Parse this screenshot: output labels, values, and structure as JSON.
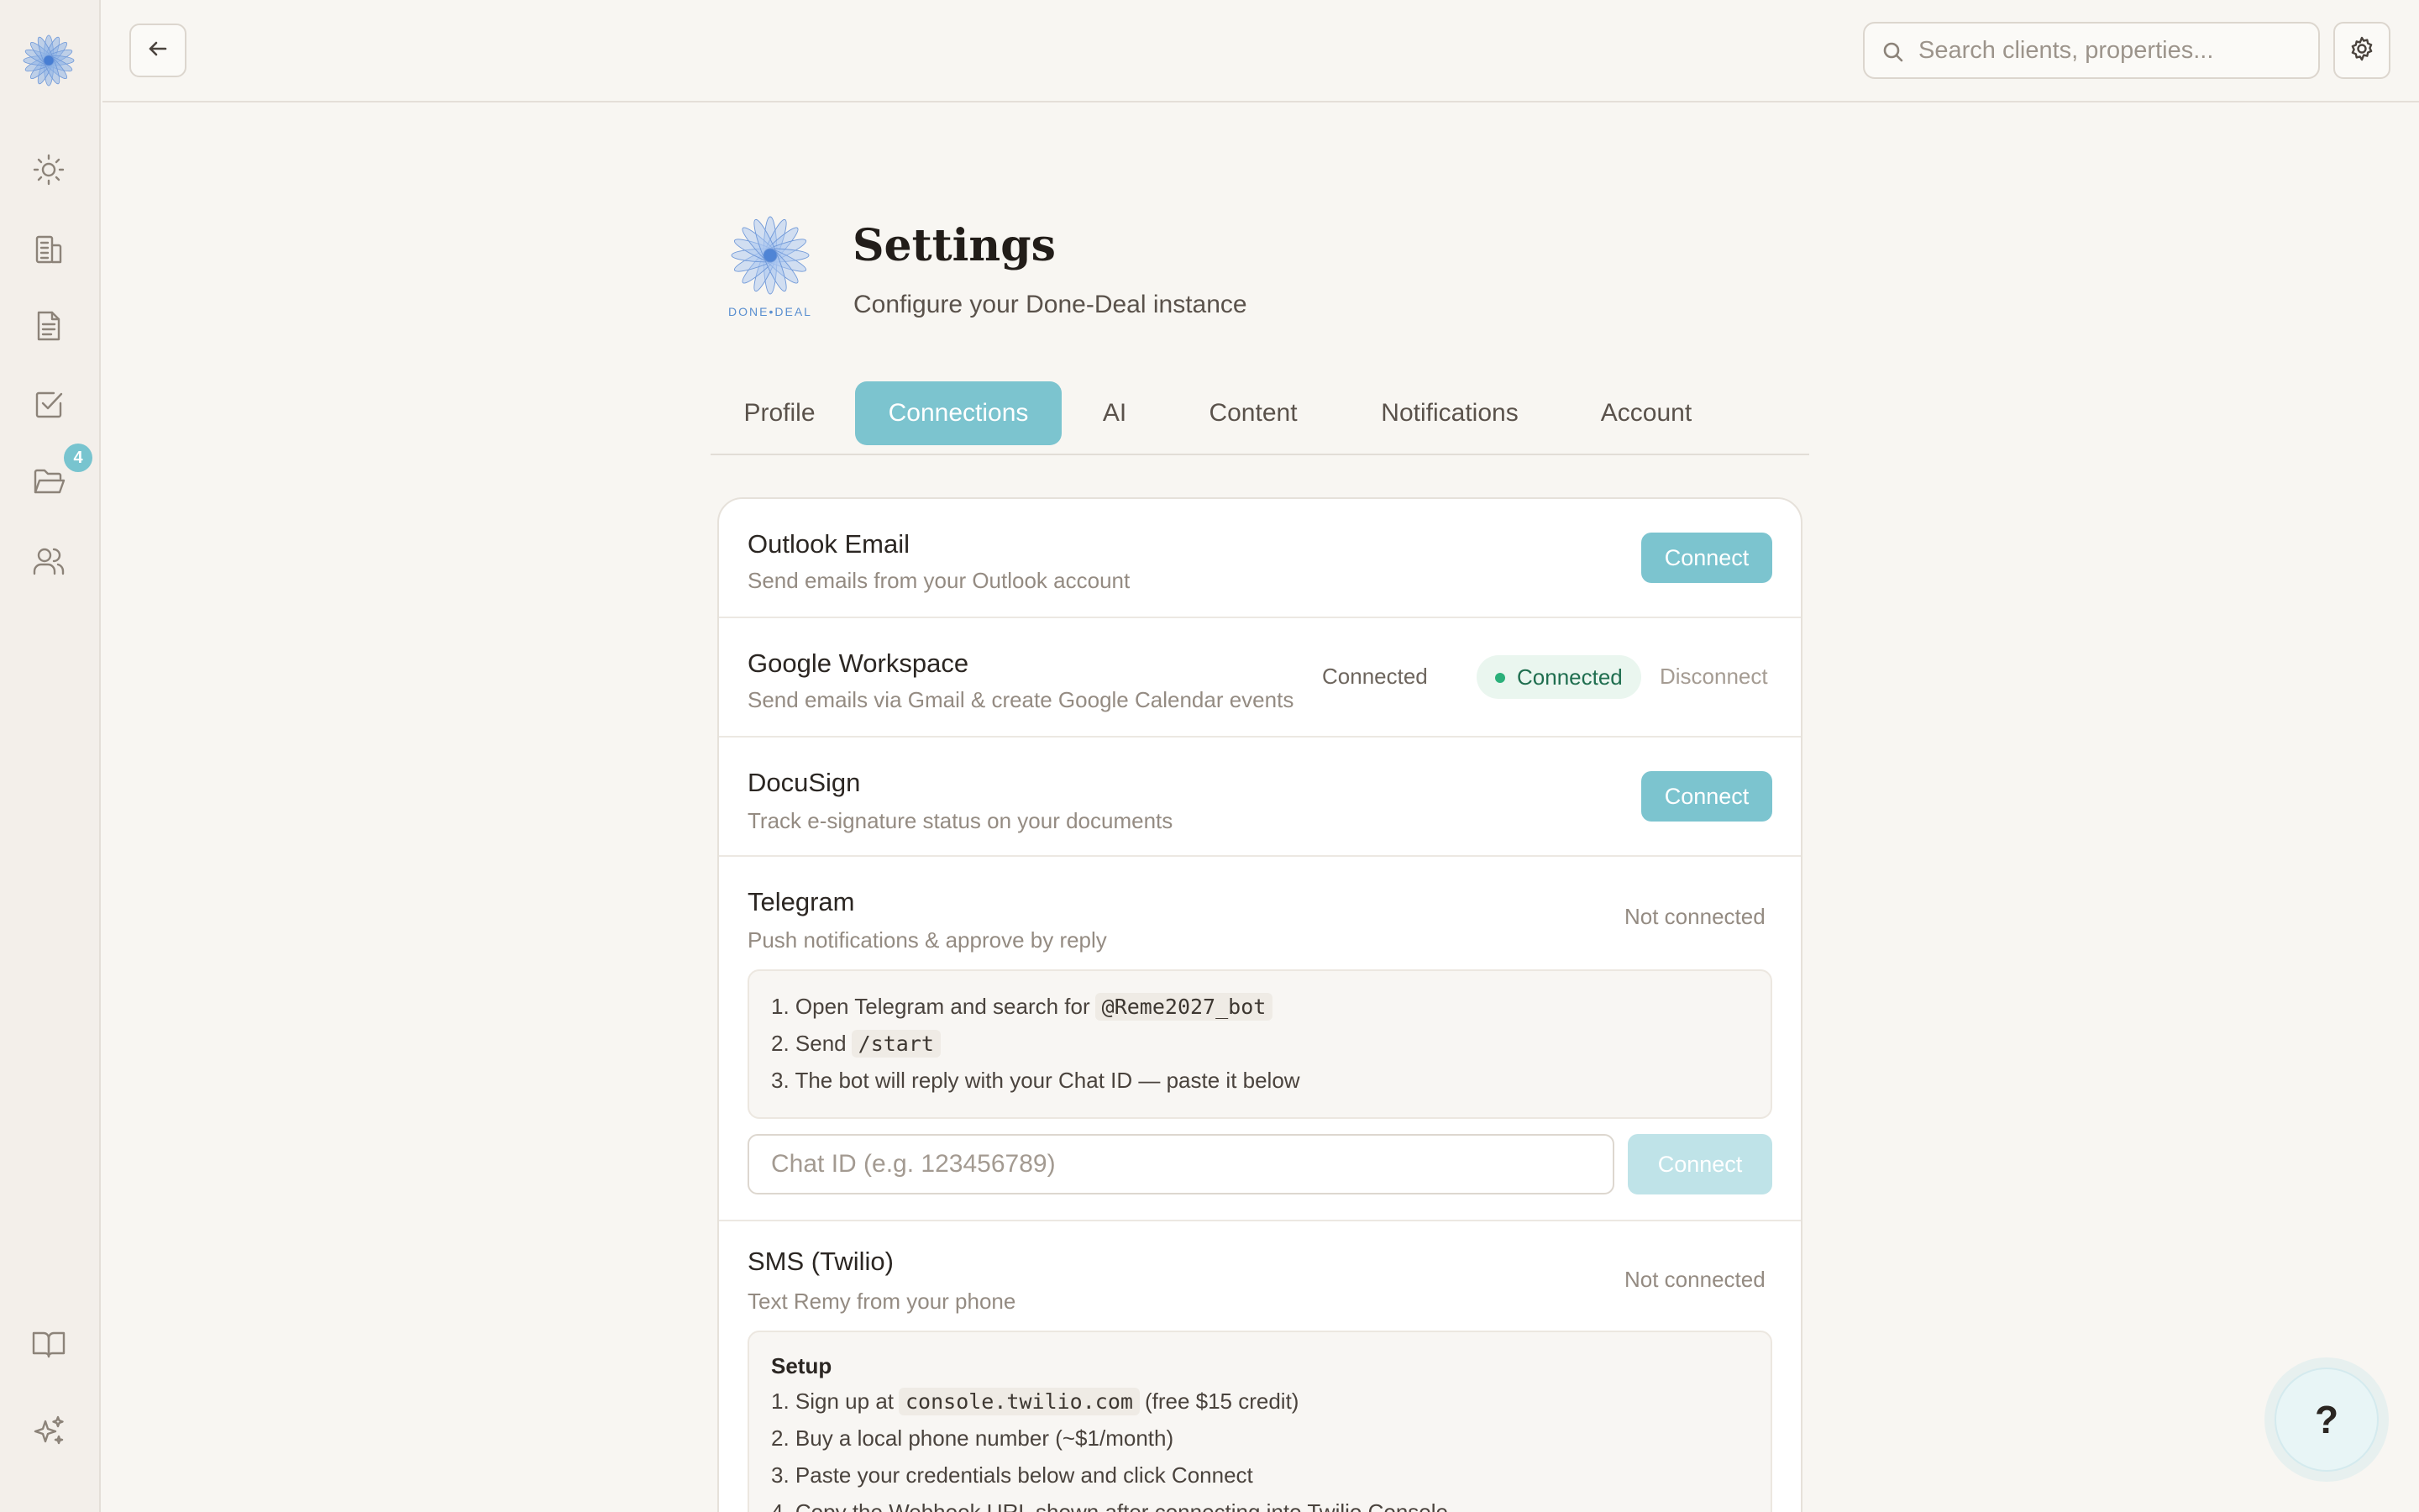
{
  "app": {
    "name": "Done-Deal",
    "logo_text": "DONE•DEAL"
  },
  "sidebar": {
    "items": [
      {
        "name": "dashboard",
        "icon": "sun-icon"
      },
      {
        "name": "properties",
        "icon": "building-icon"
      },
      {
        "name": "documents",
        "icon": "document-icon"
      },
      {
        "name": "tasks",
        "icon": "checkbox-icon"
      },
      {
        "name": "folders",
        "icon": "folder-open-icon",
        "badge": "4"
      },
      {
        "name": "clients",
        "icon": "users-icon"
      }
    ],
    "bottom": [
      {
        "name": "guide",
        "icon": "book-icon"
      },
      {
        "name": "ai",
        "icon": "sparkles-icon"
      }
    ]
  },
  "topbar": {
    "search_placeholder": "Search clients, properties..."
  },
  "header": {
    "title": "Settings",
    "subtitle": "Configure your Done-Deal instance"
  },
  "tabs": [
    {
      "label": "Profile",
      "active": false
    },
    {
      "label": "Connections",
      "active": true
    },
    {
      "label": "AI",
      "active": false
    },
    {
      "label": "Content",
      "active": false
    },
    {
      "label": "Notifications",
      "active": false
    },
    {
      "label": "Account",
      "active": false
    }
  ],
  "connections": {
    "outlook": {
      "title": "Outlook Email",
      "desc": "Send emails from your Outlook account",
      "button": "Connect"
    },
    "google": {
      "title": "Google Workspace",
      "desc": "Send emails via Gmail & create Google Calendar events",
      "status_text": "Connected",
      "pill": "Connected",
      "disconnect": "Disconnect"
    },
    "docusign": {
      "title": "DocuSign",
      "desc": "Track e-signature status on your documents",
      "button": "Connect"
    },
    "telegram": {
      "title": "Telegram",
      "desc": "Push notifications & approve by reply",
      "status": "Not connected",
      "steps": {
        "s1_pre": "1. Open Telegram and search for",
        "s1_code": "@Reme2027_bot",
        "s2_pre": "2. Send",
        "s2_code": "/start",
        "s3": "3. The bot will reply with your Chat ID — paste it below"
      },
      "input_placeholder": "Chat ID (e.g. 123456789)",
      "button": "Connect"
    },
    "sms": {
      "title": "SMS (Twilio)",
      "desc": "Text Remy from your phone",
      "status": "Not connected",
      "setup_label": "Setup",
      "steps": {
        "s1_pre": "1. Sign up at",
        "s1_code": "console.twilio.com",
        "s1_post": "(free $15 credit)",
        "s2": "2. Buy a local phone number (~$1/month)",
        "s3": "3. Paste your credentials below and click Connect",
        "s4": "4. Copy the Webhook URL shown after connecting into Twilio Console"
      }
    }
  },
  "help": {
    "label": "?"
  },
  "colors": {
    "accent": "#7cc4cf",
    "connected_green": "#2bb07a",
    "background": "#f8f6f2"
  }
}
